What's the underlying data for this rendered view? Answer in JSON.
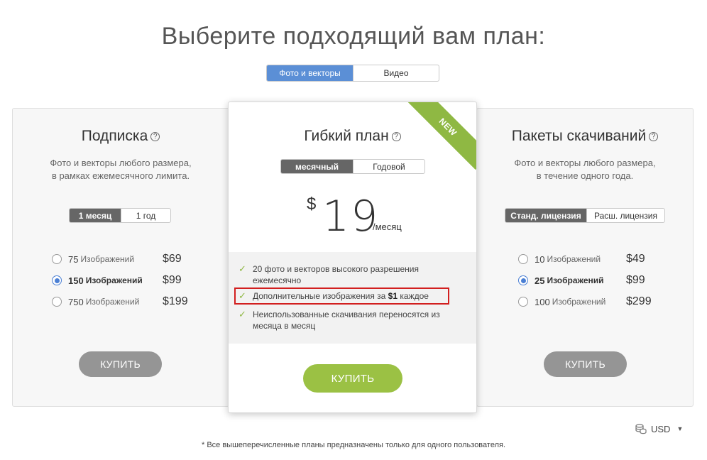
{
  "page_title": "Выберите подходящий вам план:",
  "media_tabs": [
    {
      "label": "Фото и векторы",
      "active": true
    },
    {
      "label": "Видео",
      "active": false
    }
  ],
  "subscription": {
    "title": "Подписка",
    "help_icon": "question-circle-icon",
    "description_line1": "Фото и векторы любого размера,",
    "description_line2": "в рамках ежемесячного лимита.",
    "period_tabs": [
      {
        "label": "1 месяц",
        "active": true
      },
      {
        "label": "1 год",
        "active": false
      }
    ],
    "options": [
      {
        "count": "75",
        "unit": "Изображений",
        "price": "$69",
        "selected": false
      },
      {
        "count": "150",
        "unit": "Изображений",
        "price": "$99",
        "selected": true
      },
      {
        "count": "750",
        "unit": "Изображений",
        "price": "$199",
        "selected": false
      }
    ],
    "buy_label": "КУПИТЬ"
  },
  "flexible": {
    "title": "Гибкий план",
    "help_icon": "question-circle-icon",
    "ribbon_label": "NEW",
    "period_tabs": [
      {
        "label": "месячный",
        "active": true
      },
      {
        "label": "Годовой",
        "active": false
      }
    ],
    "price_currency": "$",
    "price_value": "19",
    "price_period": "/месяц",
    "features": [
      {
        "text": "20 фото и векторов высокого разрешения ежемесячно"
      },
      {
        "text_before": "Дополнительные изображения за ",
        "text_bold": "$1",
        "text_after": " каждое",
        "highlighted": true
      },
      {
        "text": "Неиспользованные скачивания переносятся из месяца в месяц"
      }
    ],
    "buy_label": "КУПИТЬ",
    "accent_color": "#9bc144"
  },
  "packs": {
    "title": "Пакеты скачиваний",
    "help_icon": "question-circle-icon",
    "description_line1": "Фото и векторы любого размера,",
    "description_line2": "в течение одного года.",
    "license_tabs": [
      {
        "label": "Станд. лицензия",
        "active": true
      },
      {
        "label": "Расш. лицензия",
        "active": false
      }
    ],
    "options": [
      {
        "count": "10",
        "unit": "Изображений",
        "price": "$49",
        "selected": false
      },
      {
        "count": "25",
        "unit": "Изображений",
        "price": "$99",
        "selected": true
      },
      {
        "count": "100",
        "unit": "Изображений",
        "price": "$299",
        "selected": false
      }
    ],
    "buy_label": "КУПИТЬ"
  },
  "currency": {
    "label": "USD",
    "icon": "coins-icon"
  },
  "footnote": "* Все вышеперечисленные планы предназначены только для одного пользователя."
}
